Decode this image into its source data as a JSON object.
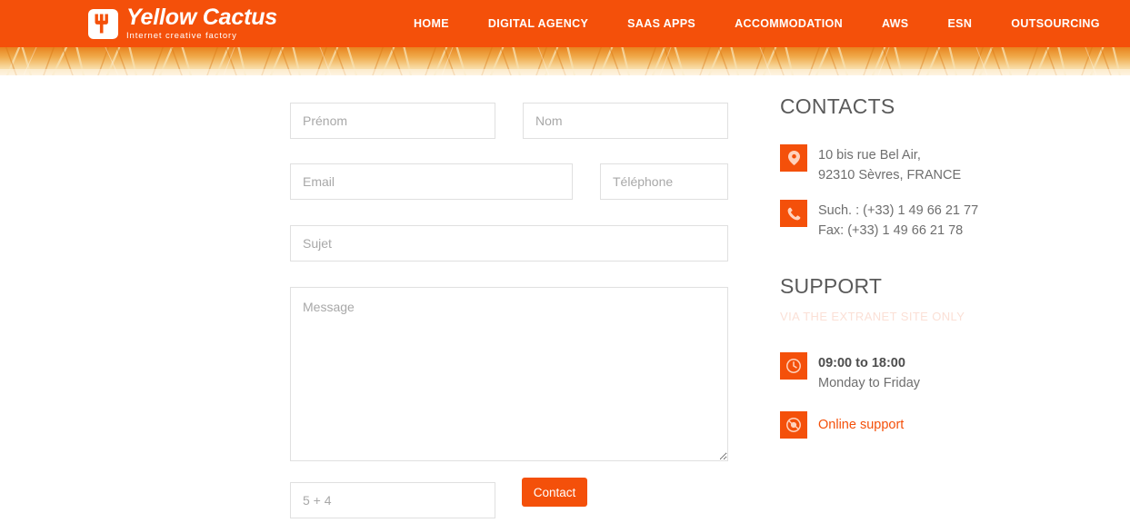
{
  "brand": {
    "name": "Yellow Cactus",
    "tagline": "Internet creative factory",
    "logo_icon": "cactus-icon",
    "accent_color": "#f4500a"
  },
  "nav": {
    "items": [
      {
        "label": "HOME"
      },
      {
        "label": "DIGITAL AGENCY"
      },
      {
        "label": "SAAS APPS"
      },
      {
        "label": "ACCOMMODATION"
      },
      {
        "label": "AWS"
      },
      {
        "label": "ESN"
      },
      {
        "label": "OUTSOURCING"
      }
    ]
  },
  "banner": {
    "description": "wheat-field-photo"
  },
  "form": {
    "fields": {
      "prenom": {
        "placeholder": "Prénom",
        "value": ""
      },
      "nom": {
        "placeholder": "Nom",
        "value": ""
      },
      "email": {
        "placeholder": "Email",
        "value": ""
      },
      "telephone": {
        "placeholder": "Téléphone",
        "value": ""
      },
      "sujet": {
        "placeholder": "Sujet",
        "value": ""
      },
      "message": {
        "placeholder": "Message",
        "value": ""
      },
      "captcha": {
        "placeholder": "5 + 4",
        "value": ""
      }
    },
    "submit_label": "Contact"
  },
  "sidebar": {
    "contacts": {
      "heading": "CONTACTS",
      "address": {
        "icon": "map-pin-icon",
        "line1": "10 bis rue Bel Air,",
        "line2": "92310 Sèvres, FRANCE"
      },
      "phone": {
        "icon": "phone-icon",
        "line1": "Such. : (+33) 1 49 66 21 77",
        "line2": "Fax: (+33) 1 49 66 21 78"
      }
    },
    "support": {
      "heading": "SUPPORT",
      "subtitle": "VIA THE EXTRANET SITE ONLY",
      "hours": {
        "icon": "clock-icon",
        "line1": "09:00 to 18:00",
        "line2": "Monday to Friday"
      },
      "online": {
        "icon": "support-globe-icon",
        "label": "Online support"
      }
    }
  }
}
